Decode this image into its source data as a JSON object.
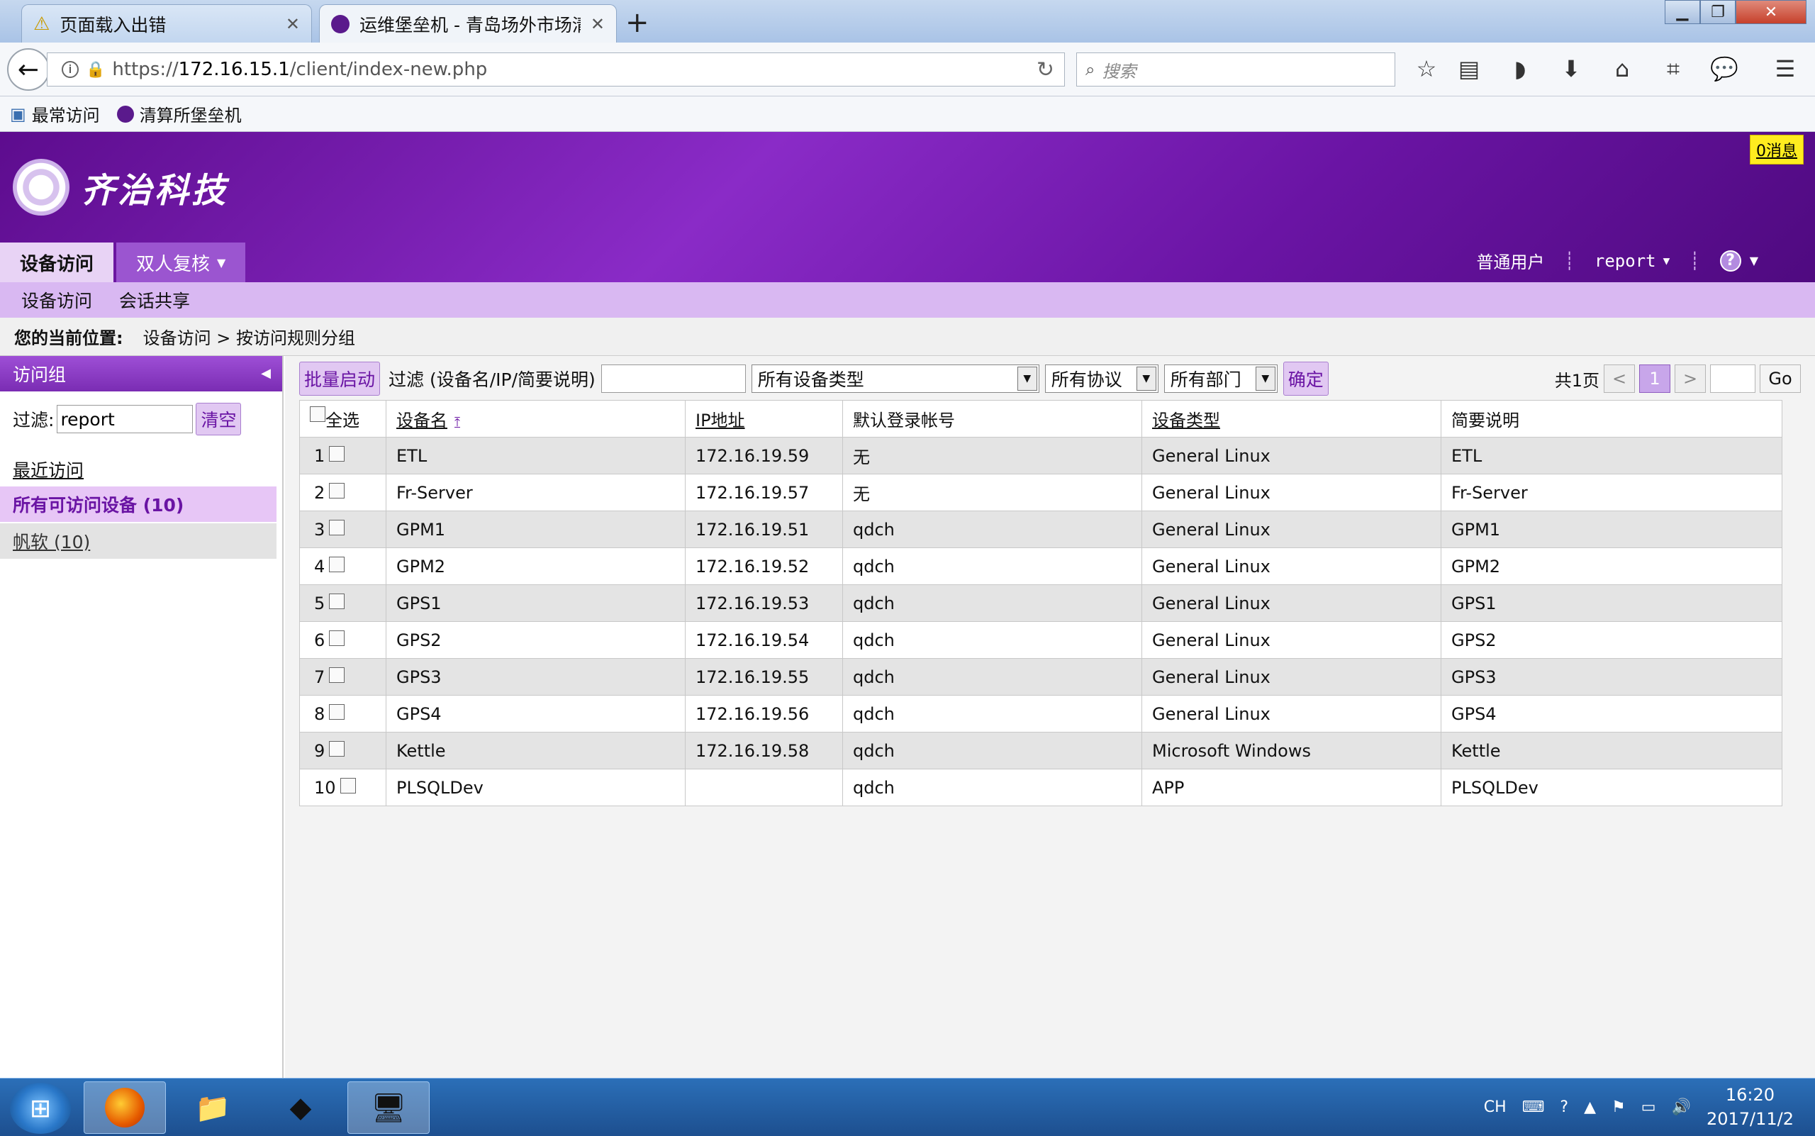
{
  "browser": {
    "tabs": [
      {
        "title": "页面载入出错",
        "active": false
      },
      {
        "title": "运维堡垒机 - 青岛场外市场清",
        "active": true
      }
    ],
    "url_prefix": "https://",
    "url_host": "172.16.15.1",
    "url_path": "/client/index-new.php",
    "search_placeholder": "搜索",
    "bookmarks": [
      "最常访问",
      "清算所堡垒机"
    ]
  },
  "header": {
    "logo_text": "齐治科技",
    "message_badge": "0消息",
    "menu_tabs": [
      "设备访问",
      "双人复核"
    ],
    "user_role": "普通用户",
    "username": "report"
  },
  "submenu": [
    "设备访问",
    "会话共享"
  ],
  "breadcrumb": {
    "label": "您的当前位置:",
    "path": "设备访问 > 按访问规则分组"
  },
  "left_panel": {
    "title": "访问组",
    "filter_label": "过滤:",
    "filter_value": "report",
    "clear_label": "清空",
    "recent_label": "最近访问",
    "all_devices_label": "所有可访问设备 (10)",
    "group_label": "帆软 (10)"
  },
  "toolbar": {
    "batch_start": "批量启动",
    "filter_label": "过滤 (设备名/IP/简要说明)",
    "device_type_select": "所有设备类型",
    "protocol_select": "所有协议",
    "dept_select": "所有部门",
    "confirm": "确定"
  },
  "pager": {
    "total": "共1页",
    "prev": "<",
    "current": "1",
    "next": ">",
    "go": "Go"
  },
  "table": {
    "headers": [
      "全选",
      "设备名",
      "IP地址",
      "默认登录帐号",
      "设备类型",
      "简要说明"
    ],
    "rows": [
      {
        "num": "1",
        "name": "ETL",
        "ip": "172.16.19.59",
        "account": "无",
        "type": "General Linux",
        "desc": "ETL"
      },
      {
        "num": "2",
        "name": "Fr-Server",
        "ip": "172.16.19.57",
        "account": "无",
        "type": "General Linux",
        "desc": "Fr-Server"
      },
      {
        "num": "3",
        "name": "GPM1",
        "ip": "172.16.19.51",
        "account": "qdch",
        "type": "General Linux",
        "desc": "GPM1"
      },
      {
        "num": "4",
        "name": "GPM2",
        "ip": "172.16.19.52",
        "account": "qdch",
        "type": "General Linux",
        "desc": "GPM2"
      },
      {
        "num": "5",
        "name": "GPS1",
        "ip": "172.16.19.53",
        "account": "qdch",
        "type": "General Linux",
        "desc": "GPS1"
      },
      {
        "num": "6",
        "name": "GPS2",
        "ip": "172.16.19.54",
        "account": "qdch",
        "type": "General Linux",
        "desc": "GPS2"
      },
      {
        "num": "7",
        "name": "GPS3",
        "ip": "172.16.19.55",
        "account": "qdch",
        "type": "General Linux",
        "desc": "GPS3"
      },
      {
        "num": "8",
        "name": "GPS4",
        "ip": "172.16.19.56",
        "account": "qdch",
        "type": "General Linux",
        "desc": "GPS4"
      },
      {
        "num": "9",
        "name": "Kettle",
        "ip": "172.16.19.58",
        "account": "qdch",
        "type": "Microsoft Windows",
        "desc": "Kettle"
      },
      {
        "num": "10",
        "name": "PLSQLDev",
        "ip": "",
        "account": "qdch",
        "type": "APP",
        "desc": "PLSQLDev"
      }
    ]
  },
  "taskbar": {
    "lang": "CH",
    "time": "16:20",
    "date": "2017/11/2"
  },
  "colors": {
    "brand_purple": "#6a14a4",
    "highlight": "#e7c6f6"
  }
}
